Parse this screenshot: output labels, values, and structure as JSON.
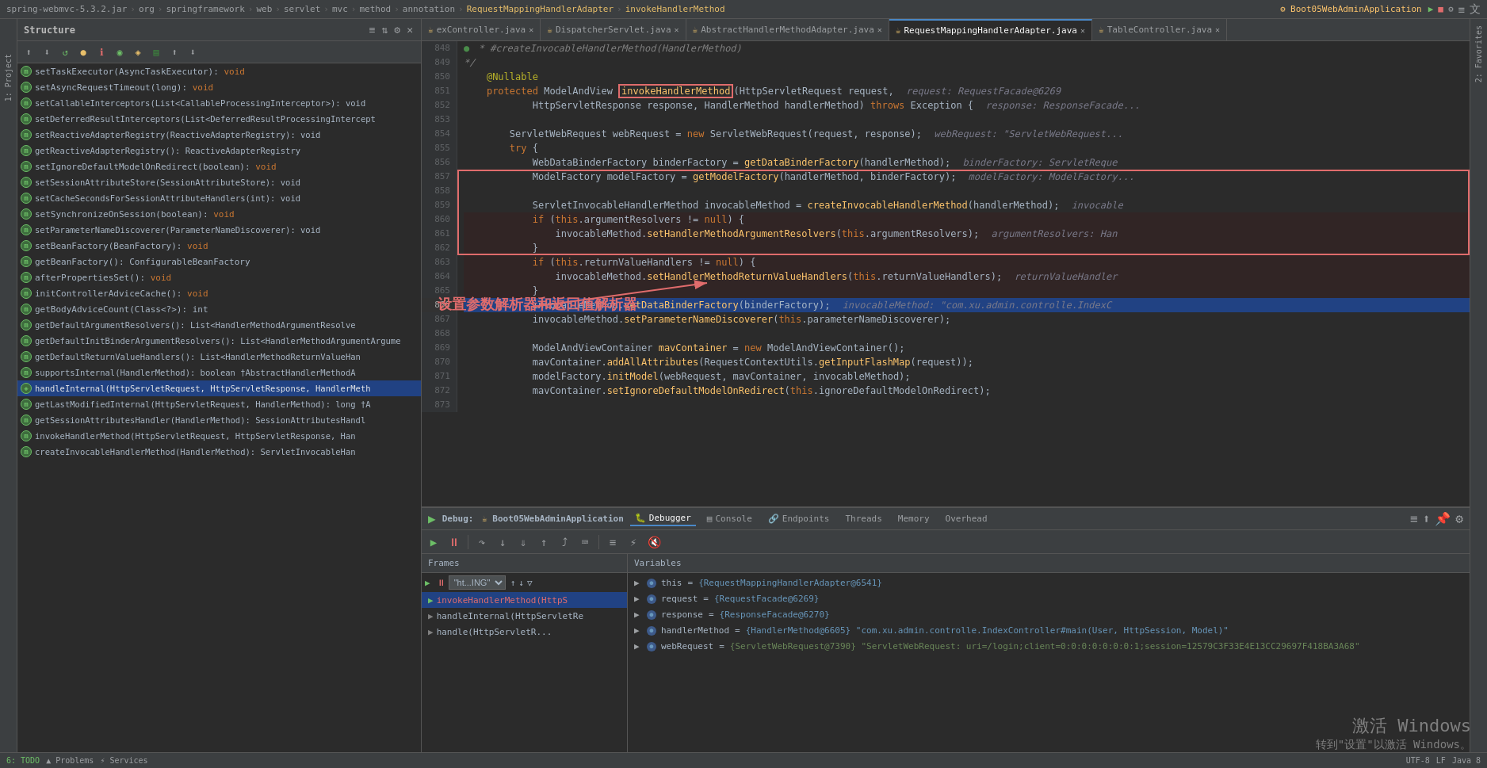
{
  "breadcrumb": {
    "parts": [
      "spring-webmvc-5.3.2.jar",
      "org",
      "springframework",
      "web",
      "servlet",
      "mvc",
      "method",
      "annotation",
      "RequestMappingHandlerAdapter",
      "invokeHandlerMethod"
    ],
    "app": "Boot05WebAdminApplication"
  },
  "structure": {
    "title": "Structure",
    "items": [
      {
        "badge": "m",
        "text": "setTaskExecutor(AsyncTaskExecutor): void"
      },
      {
        "badge": "m",
        "text": "setAsyncRequestTimeout(long): void"
      },
      {
        "badge": "m",
        "text": "setCallableInterceptors(List<CallableProcessingInterceptor>): void"
      },
      {
        "badge": "m",
        "text": "setDeferredResultInterceptors(List<DeferredResultProcessingIntercept"
      },
      {
        "badge": "m",
        "text": "setReactiveAdapterRegistry(ReactiveAdapterRegistry): void"
      },
      {
        "badge": "m",
        "text": "getReactiveAdapterRegistry(): ReactiveAdapterRegistry"
      },
      {
        "badge": "m",
        "text": "setIgnoreDefaultModelOnRedirect(boolean): void"
      },
      {
        "badge": "m",
        "text": "setSessionAttributeStore(SessionAttributeStore): void"
      },
      {
        "badge": "m",
        "text": "setCacheSecondsForSessionAttributeHandlers(int): void"
      },
      {
        "badge": "m",
        "text": "setSynchronizeOnSession(boolean): void"
      },
      {
        "badge": "m",
        "text": "setParameterNameDiscoverer(ParameterNameDiscoverer): void"
      },
      {
        "badge": "m",
        "text": "setBeanFactory(BeanFactory): void"
      },
      {
        "badge": "m",
        "text": "getBeanFactory(): ConfigurableBeanFactory"
      },
      {
        "badge": "m",
        "text": "afterPropertiesSet(): void"
      },
      {
        "badge": "m",
        "text": "initControllerAdviceCache(): void"
      },
      {
        "badge": "m",
        "text": "getBodyAdviceCount(Class<?>): int"
      },
      {
        "badge": "m",
        "text": "getDefaultArgumentResolvers(): List<HandlerMethodArgumentResolve"
      },
      {
        "badge": "m",
        "text": "getDefaultInitBinderArgumentResolvers(): List<HandlerMethodArgumentArgume"
      },
      {
        "badge": "m",
        "text": "getDefaultReturnValueHandlers(): List<HandlerMethodReturnValueHan"
      },
      {
        "badge": "m",
        "text": "supportsInternal(HandlerMethod): boolean †AbstractHandlerMethodA"
      },
      {
        "badge": "special",
        "text": "handleInternal(HttpServletRequest, HttpServletResponse, HandlerMeth",
        "selected": true
      },
      {
        "badge": "m",
        "text": "getLastModifiedInternal(HttpServletRequest, HandlerMethod): long †A"
      },
      {
        "badge": "m",
        "text": "getSessionAttributesHandler(HandlerMethod): SessionAttributesHandl"
      },
      {
        "badge": "m",
        "text": "invokeHandlerMethod(HttpServletRequest, HttpServletResponse, Han"
      },
      {
        "badge": "m",
        "text": "createInvocableHandlerMethod(HandlerMethod): ServletInvocableHan"
      }
    ]
  },
  "tabs": [
    {
      "label": "exController.java",
      "active": false,
      "modified": false
    },
    {
      "label": "DispatcherServlet.java",
      "active": false,
      "modified": false
    },
    {
      "label": "AbstractHandlerMethodAdapter.java",
      "active": false,
      "modified": false
    },
    {
      "label": "RequestMappingHandlerAdapter.java",
      "active": true,
      "modified": false
    },
    {
      "label": "TableController.java",
      "active": false,
      "modified": false
    }
  ],
  "code_lines": [
    {
      "num": "849",
      "content": "    */"
    },
    {
      "num": "850",
      "content": "@Nullable"
    },
    {
      "num": "851",
      "content": "protected ModelAndView invokeHandlerMethod(HttpServletRequest request,"
    },
    {
      "num": "852",
      "content": "        HttpServletResponse response, HandlerMethod handlerMethod) throws Exception {"
    },
    {
      "num": "853",
      "content": ""
    },
    {
      "num": "854",
      "content": "    ServletWebRequest webRequest = new ServletWebRequest(request, response);"
    },
    {
      "num": "855",
      "content": "    try {"
    },
    {
      "num": "856",
      "content": "        WebDataBinderFactory binderFactory = getDataBinderFactory(handlerMethod);"
    },
    {
      "num": "857",
      "content": "        ModelFactory modelFactory = getModelFactory(handlerMethod, binderFactory);"
    },
    {
      "num": "858",
      "content": ""
    },
    {
      "num": "859",
      "content": "        ServletInvocableHandlerMethod invocableMethod = createInvocableHandlerMethod(handlerMethod);"
    },
    {
      "num": "860",
      "content": "        if (this.argumentResolvers != null) {"
    },
    {
      "num": "861",
      "content": "            invocableMethod.setHandlerMethodArgumentResolvers(this.argumentResolvers);"
    },
    {
      "num": "862",
      "content": "        }"
    },
    {
      "num": "863",
      "content": "        if (this.returnValueHandlers != null) {"
    },
    {
      "num": "864",
      "content": "            invocableMethod.setHandlerMethodReturnValueHandlers(this.returnValueHandlers);"
    },
    {
      "num": "865",
      "content": "        }"
    },
    {
      "num": "866",
      "content": "        invocableMethod.setDataBinderFactory(binderFactory);"
    },
    {
      "num": "867",
      "content": "        invocableMethod.setParameterNameDiscoverer(this.parameterNameDiscoverer);"
    },
    {
      "num": "868",
      "content": ""
    },
    {
      "num": "869",
      "content": "        ModelAndViewContainer mavContainer = new ModelAndViewContainer();"
    },
    {
      "num": "870",
      "content": "        mavContainer.addAllAttributes(RequestContextUtils.getInputFlashMap(request));"
    },
    {
      "num": "871",
      "content": "        modelFactory.initModel(webRequest, mavContainer, invocableMethod);"
    },
    {
      "num": "872",
      "content": "        mavContainer.setIgnoreDefaultModelOnRedirect(this.ignoreDefaultModelOnRedirect);"
    },
    {
      "num": "873",
      "content": ""
    }
  ],
  "annotation": {
    "text": "设置参数解析器和返回值解析器",
    "color": "#e06c6c"
  },
  "debug": {
    "title": "Debug:",
    "app_name": "Boot05WebAdminApplication",
    "tabs": [
      {
        "label": "Debugger",
        "active": true,
        "icon": "🐛"
      },
      {
        "label": "Console",
        "active": false,
        "icon": "▤"
      },
      {
        "label": "Endpoints",
        "active": false,
        "icon": "🔗"
      },
      {
        "label": "Threads",
        "active": false
      },
      {
        "label": "Memory",
        "active": false
      },
      {
        "label": "Overhead",
        "active": false
      }
    ],
    "frames_header": "Frames",
    "variables_header": "Variables",
    "thread_label": "\"ht...ING\"",
    "frames": [
      {
        "label": "invokeHandlerMethod(HttpS",
        "selected": true
      },
      {
        "label": "handleInternal(HttpServletRe",
        "selected": false
      },
      {
        "label": "handle(HttpServletR...",
        "selected": false
      }
    ],
    "variables": [
      {
        "indent": 0,
        "expand": true,
        "name": "this",
        "eq": "=",
        "val": "{RequestMappingHandlerAdapter@6541}"
      },
      {
        "indent": 0,
        "expand": true,
        "name": "request",
        "eq": "=",
        "val": "{RequestFacade@6269}"
      },
      {
        "indent": 0,
        "expand": true,
        "name": "response",
        "eq": "=",
        "val": "{ResponseFacade@6270}"
      },
      {
        "indent": 0,
        "expand": true,
        "name": "handlerMethod",
        "eq": "=",
        "val": "{HandlerMethod@6605} \"com.xu.admin.controlle.IndexController#main(User, HttpSession, Model)\""
      },
      {
        "indent": 0,
        "expand": true,
        "name": "webRequest",
        "eq": "=",
        "val": "{ServletWebRequest@7390} \"ServletWebRequest: uri=/login;client=0:0:0:0:0:0:0:1;session=12579C3F33E4E13CC29697F418BA3A68\""
      }
    ]
  },
  "windows": {
    "line1": "激活 Windows",
    "line2": "转到\"设置\"以激活 Windows。"
  },
  "icons": {
    "play": "▶",
    "stop": "■",
    "pause": "⏸",
    "step_over": "↷",
    "step_into": "↓",
    "step_out": "↑",
    "resume": "▶",
    "rerun": "↺",
    "close": "✕",
    "expand": "▶",
    "collapse": "▼",
    "settings": "⚙"
  }
}
